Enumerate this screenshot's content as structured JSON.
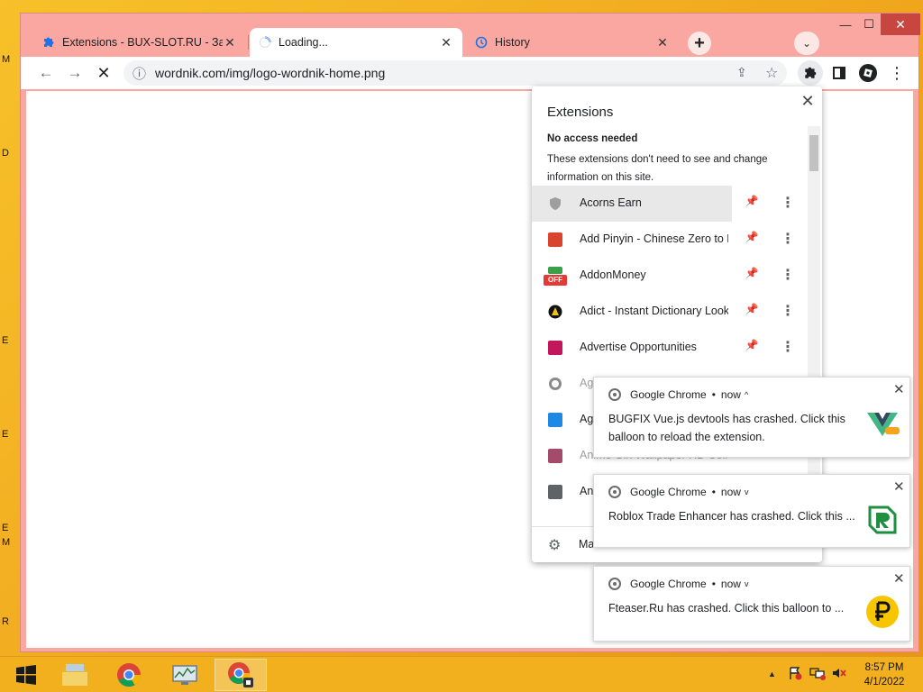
{
  "desktop": {
    "edge_letters": [
      "M",
      "D",
      "E",
      "E",
      "E",
      "M",
      "R"
    ]
  },
  "window": {
    "min": "—",
    "max": "☐",
    "close": "✕"
  },
  "tabs": [
    {
      "label": "Extensions - BUX-SLOT.RU - Зара",
      "icon": "puzzle-icon"
    },
    {
      "label": "Loading...",
      "icon": "spinner-icon"
    },
    {
      "label": "History",
      "icon": "history-icon"
    }
  ],
  "tab_close": "✕",
  "new_tab": "+",
  "tab_search": "⌄",
  "toolbar": {
    "url": "wordnik.com/img/logo-wordnik-home.png",
    "back": "←",
    "forward": "→",
    "stop": "✕",
    "info": "ⓘ",
    "share": "⇪",
    "star": "☆",
    "menu": "⋮"
  },
  "extensions": {
    "title": "Extensions",
    "close": "✕",
    "section": "No access needed",
    "description": "These extensions don't need to see and change information on this site.",
    "items": [
      {
        "name": "Acorns Earn",
        "color": "#9e9e9e"
      },
      {
        "name": "Add Pinyin - Chinese Zero to Hero",
        "color": "#d8442e"
      },
      {
        "name": "AddonMoney",
        "color": "#3aa049",
        "badge": "OFF"
      },
      {
        "name": "Adict - Instant Dictionary Lookup",
        "color": "#f2c314"
      },
      {
        "name": "Advertise Opportunities",
        "color": "#c2185b"
      },
      {
        "name": "Ag",
        "color": "#8a8a8a"
      },
      {
        "name": "Ag",
        "color": "#1e88e5"
      },
      {
        "name": "Anime Girl Wallpaper HD Collection",
        "color": "#a44a6a"
      },
      {
        "name": "An",
        "color": "#5f6368"
      }
    ],
    "pin": "📌",
    "more": "⋮",
    "manage": "Ma",
    "gear": "⚙"
  },
  "notifications": [
    {
      "app": "Google Chrome",
      "time": "now",
      "chevron": "^",
      "text": "BUGFIX Vue.js devtools has crashed. Click this balloon to reload the extension.",
      "icon": "vue-devtools-icon"
    },
    {
      "app": "Google Chrome",
      "time": "now",
      "chevron": "v",
      "text": "Roblox Trade Enhancer has crashed. Click this ...",
      "icon": "roblox-icon"
    },
    {
      "app": "Google Chrome",
      "time": "now",
      "chevron": "v",
      "text": "Fteaser.Ru has crashed. Click this balloon to ...",
      "icon": "ruble-icon"
    }
  ],
  "notif_close": "✕",
  "notif_dot": "•",
  "taskbar": {
    "time": "8:57 PM",
    "date": "4/1/2022",
    "tray_up": "▲"
  }
}
